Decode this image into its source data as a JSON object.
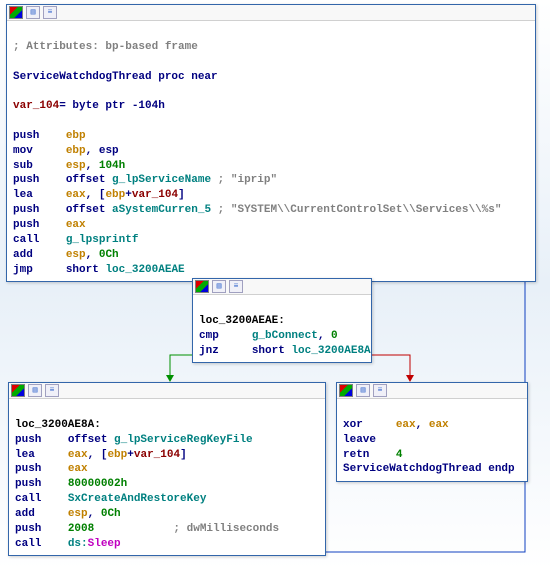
{
  "node1": {
    "comment": "; Attributes: bp-based frame",
    "procdecl": "ServiceWatchdogThread proc near",
    "vardecl_name": "var_104",
    "vardecl_rest": "= byte ptr -104h",
    "l1_op": "push",
    "l1_arg": "ebp",
    "l2_op": "mov",
    "l2_a": "ebp",
    "l2_b": ", esp",
    "l3_op": "sub",
    "l3_a": "esp",
    "l3_b": ", ",
    "l3_c": "104h",
    "l4_op": "push",
    "l4_a": "offset ",
    "l4_b": "g_lpServiceName",
    "l4_c": " ; \"iprip\"",
    "l5_op": "lea",
    "l5_a": "eax",
    "l5_b": ", [",
    "l5_c": "ebp",
    "l5_d": "+",
    "l5_e": "var_104",
    "l5_f": "]",
    "l6_op": "push",
    "l6_a": "offset ",
    "l6_b": "aSystemCurren_5",
    "l6_c": " ; \"SYSTEM\\\\CurrentControlSet\\\\Services\\\\%s\"",
    "l7_op": "push",
    "l7_a": "eax",
    "l8_op": "call",
    "l8_a": "g_lpsprintf",
    "l9_op": "add",
    "l9_a": "esp",
    "l9_b": ", ",
    "l9_c": "0Ch",
    "l10_op": "jmp",
    "l10_a": "short ",
    "l10_b": "loc_3200AEAE"
  },
  "node2": {
    "label": "loc_3200AEAE:",
    "l1_op": "cmp",
    "l1_a": "g_bConnect",
    "l1_b": ", ",
    "l1_c": "0",
    "l2_op": "jnz",
    "l2_a": "short ",
    "l2_b": "loc_3200AE8A"
  },
  "node3": {
    "label": "loc_3200AE8A:",
    "l1_op": "push",
    "l1_a": "offset ",
    "l1_b": "g_lpServiceRegKeyFile",
    "l2_op": "lea",
    "l2_a": "eax",
    "l2_b": ", [",
    "l2_c": "ebp",
    "l2_d": "+",
    "l2_e": "var_104",
    "l2_f": "]",
    "l3_op": "push",
    "l3_a": "eax",
    "l4_op": "push",
    "l4_a": "80000002h",
    "l5_op": "call",
    "l5_a": "SxCreateAndRestoreKey",
    "l6_op": "add",
    "l6_a": "esp",
    "l6_b": ", ",
    "l6_c": "0Ch",
    "l7_op": "push",
    "l7_a": "2008",
    "l7_b": "            ; dwMilliseconds",
    "l8_op": "call",
    "l8_a": "ds:",
    "l8_b": "Sleep"
  },
  "node4": {
    "l1_op": "xor",
    "l1_a": "eax",
    "l1_b": ", ",
    "l1_c": "eax",
    "l2_op": "leave",
    "l3_op": "retn",
    "l3_a": "4",
    "l4_a": "ServiceWatchdogThread",
    "l4_b": " endp"
  }
}
